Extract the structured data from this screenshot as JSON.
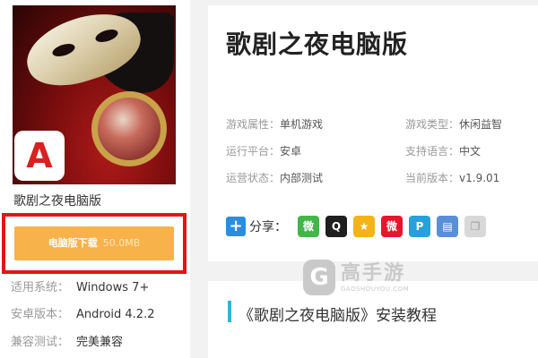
{
  "sidebar": {
    "game_name": "歌剧之夜电脑版",
    "badge_glyph": "A",
    "download": {
      "label": "电脑版下载",
      "size": "50.0MB"
    },
    "meta": [
      {
        "key": "适用系统：",
        "value": "Windows 7+"
      },
      {
        "key": "安卓版本：",
        "value": "Android 4.2.2"
      },
      {
        "key": "兼容测试：",
        "value": "完美兼容"
      }
    ]
  },
  "header": {
    "title": "歌剧之夜电脑版"
  },
  "info": [
    {
      "key": "游戏属性：",
      "value": "单机游戏"
    },
    {
      "key": "游戏类型：",
      "value": "休闲益智"
    },
    {
      "key": "运行平台：",
      "value": "安卓"
    },
    {
      "key": "支持语言：",
      "value": "中文"
    },
    {
      "key": "运营状态：",
      "value": "内部测试"
    },
    {
      "key": "当前版本：",
      "value": "v1.9.01"
    }
  ],
  "share": {
    "plus": "+",
    "label": "分享：",
    "icons": [
      {
        "name": "wechat-icon",
        "color": "#43b549",
        "glyph": "微"
      },
      {
        "name": "qq-icon",
        "color": "#1f1f1f",
        "glyph": "Q"
      },
      {
        "name": "qzone-icon",
        "color": "#f2b418",
        "glyph": "★"
      },
      {
        "name": "weibo-icon",
        "color": "#e6162d",
        "glyph": "微"
      },
      {
        "name": "tencent-weibo-icon",
        "color": "#2aa0d8",
        "glyph": "P"
      },
      {
        "name": "print-icon",
        "color": "#5a8fd6",
        "glyph": "▤"
      },
      {
        "name": "copy-icon",
        "color": "#d8d8d8",
        "glyph": "❐"
      }
    ]
  },
  "section": {
    "title": "《歌剧之夜电脑版》安装教程"
  },
  "watermark": {
    "glyph": "G",
    "cn": "高手游",
    "en": "GAOSHOUYOU.COM"
  }
}
